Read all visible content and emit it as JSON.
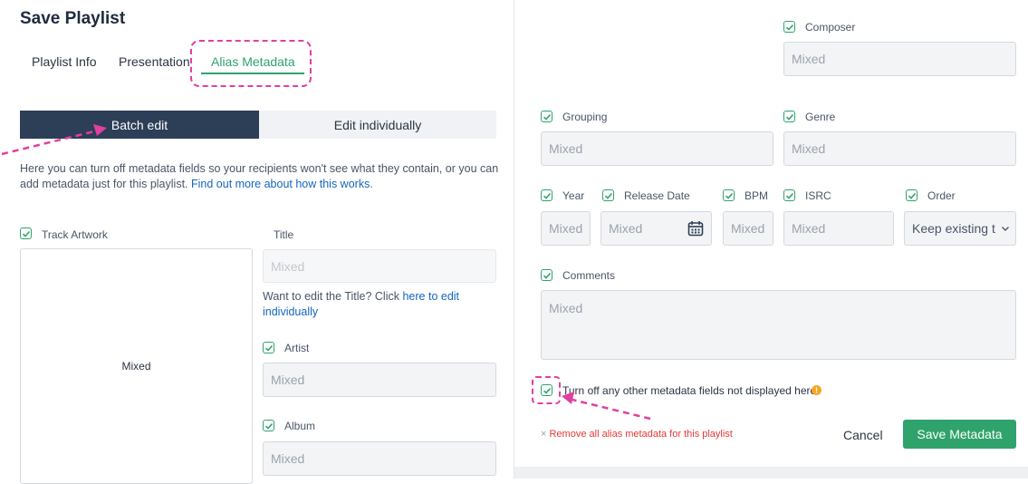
{
  "header": {
    "title": "Save Playlist"
  },
  "tabs": [
    {
      "label": "Playlist Info"
    },
    {
      "label": "Presentation"
    },
    {
      "label": "Alias Metadata"
    }
  ],
  "segmented": {
    "batch": "Batch edit",
    "individual": "Edit individually"
  },
  "description": {
    "text": "Here you can turn off metadata fields so your recipients won't see what they contain, or you can add metadata just for this playlist.",
    "link": "Find out more about how this works."
  },
  "left": {
    "track_artwork_label": "Track Artwork",
    "artwork_value": "Mixed",
    "title_label": "Title",
    "title_value": "Mixed",
    "title_help": "Want to edit the Title? Click",
    "title_help_link": "here to edit individually",
    "artist_label": "Artist",
    "artist_value": "Mixed",
    "album_label": "Album",
    "album_value": "Mixed"
  },
  "right": {
    "composer_label": "Composer",
    "composer_value": "Mixed",
    "grouping_label": "Grouping",
    "grouping_value": "Mixed",
    "genre_label": "Genre",
    "genre_value": "Mixed",
    "year_label": "Year",
    "year_value": "Mixed",
    "release_label": "Release Date",
    "release_value": "Mixed",
    "bpm_label": "BPM",
    "bpm_value": "Mixed",
    "isrc_label": "ISRC",
    "isrc_value": "Mixed",
    "order_label": "Order",
    "order_value": "Keep existing t",
    "comments_label": "Comments",
    "comments_value": "Mixed",
    "turn_off_label": "Turn off any other metadata fields not displayed here",
    "info_icon": "!"
  },
  "footer": {
    "remove_icon": "×",
    "remove_label": "Remove all alias metadata for this playlist",
    "cancel": "Cancel",
    "save": "Save Metadata"
  },
  "colors": {
    "accent": "#2fa36b",
    "navy": "#2d3e57",
    "annotation": "#e040a0",
    "danger": "#e53935"
  }
}
